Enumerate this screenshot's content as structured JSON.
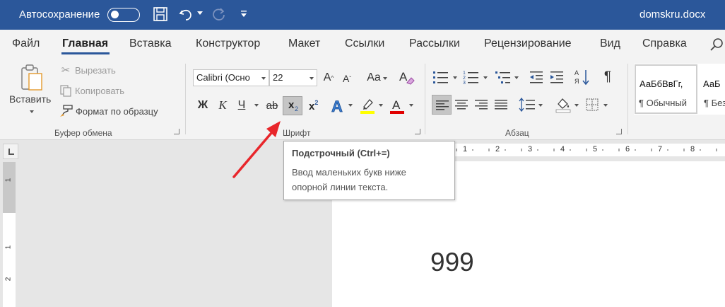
{
  "titlebar": {
    "autosave_label": "Автосохранение",
    "doc_name": "domskru.docx"
  },
  "tabs": [
    "Файл",
    "Главная",
    "Вставка",
    "Конструктор",
    "Макет",
    "Ссылки",
    "Рассылки",
    "Рецензирование",
    "Вид",
    "Справка"
  ],
  "clipboard": {
    "paste": "Вставить",
    "cut": "Вырезать",
    "copy": "Копировать",
    "format_painter": "Формат по образцу",
    "group": "Буфер обмена"
  },
  "font": {
    "name": "Calibri (Осно",
    "size": "22",
    "case_label": "Aa",
    "bold": "Ж",
    "italic": "К",
    "underline": "Ч",
    "strike": "ab",
    "subscript": "x",
    "subscript_sub": "2",
    "superscript": "x",
    "superscript_sup": "2",
    "group": "Шрифт"
  },
  "paragraph": {
    "group": "Абзац",
    "pilcrow": "¶"
  },
  "styles": {
    "normal_preview": "АаБбВвГг,",
    "normal_name": "¶ Обычный",
    "next_preview": "АаБ",
    "next_name": "¶ Без"
  },
  "tooltip": {
    "title": "Подстрочный (Ctrl+=)",
    "desc_line1": "Ввод маленьких букв ниже",
    "desc_line2": "опорной линии текста."
  },
  "ruler": {
    "h_marks": [
      "1",
      "2",
      "3",
      "4",
      "5",
      "6",
      "7",
      "8"
    ],
    "v_marks": [
      "1",
      "1",
      "2"
    ]
  },
  "document": {
    "text": "999"
  },
  "colors": {
    "titlebar": "#2b579a",
    "highlight": "#ffff00",
    "font_color": "#e00000",
    "annotation_arrow": "#e8262b"
  }
}
